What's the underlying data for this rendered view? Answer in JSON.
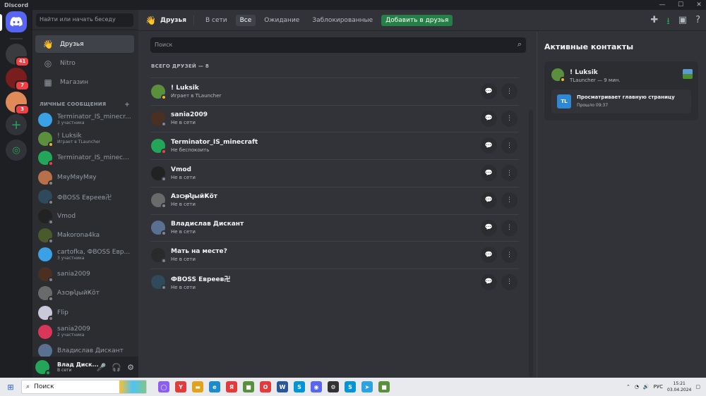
{
  "window": {
    "title": "Discord",
    "controls": [
      "—",
      "☐",
      "✕"
    ]
  },
  "guilds": [
    {
      "name": "server-1",
      "badge": "41",
      "color": "#3a3b3e"
    },
    {
      "name": "server-2",
      "badge": "7",
      "color": "#7a1d1d"
    },
    {
      "name": "server-3",
      "badge": "3",
      "color": "#e08a5a"
    }
  ],
  "sidebar": {
    "search_placeholder": "Найти или начать беседу",
    "nav": [
      {
        "label": "Друзья",
        "icon": "👋"
      },
      {
        "label": "Nitro",
        "icon": "◎"
      },
      {
        "label": "Магазин",
        "icon": "▦"
      }
    ],
    "dm_header": "ЛИЧНЫЕ СООБЩЕНИЯ",
    "dm_add": "+",
    "dms": [
      {
        "name": "Terminator_IS_minecr...",
        "sub": "3 участника",
        "color": "#3ba1e6",
        "status": ""
      },
      {
        "name": "! Luksik",
        "sub": "Играет в TLauncher",
        "color": "#5a8f3c",
        "status": "idle"
      },
      {
        "name": "Terminator_IS_minecra...",
        "sub": "",
        "color": "#23a55a",
        "status": "dnd"
      },
      {
        "name": "МяуМяуМяу",
        "sub": "",
        "color": "#b8704a",
        "status": "off"
      },
      {
        "name": "ФBOSS Евреев卍",
        "sub": "",
        "color": "#2f4a5a",
        "status": "off"
      },
      {
        "name": "Vmod",
        "sub": "",
        "color": "#222",
        "status": "off"
      },
      {
        "name": "Makorona4ka",
        "sub": "",
        "color": "#4a5a2a",
        "status": "off"
      },
      {
        "name": "cartofka, ФBOSS Евр...",
        "sub": "3 участника",
        "color": "#3ba1e6",
        "status": ""
      },
      {
        "name": "sania2009",
        "sub": "",
        "color": "#4a3020",
        "status": "off"
      },
      {
        "name": "АзѻᵽʮыйҜӧт",
        "sub": "",
        "color": "#6a6a6a",
        "status": "off"
      },
      {
        "name": "Flip",
        "sub": "",
        "color": "#c9c9d9",
        "status": "off"
      },
      {
        "name": "sania2009",
        "sub": "2 участника",
        "color": "#d9365a",
        "status": ""
      },
      {
        "name": "Владислав Дискант",
        "sub": "",
        "color": "#5a7090",
        "status": ""
      }
    ]
  },
  "user": {
    "name": "Влад Диск...",
    "status": "В сети",
    "color": "#23a55a",
    "icons": [
      "🎤",
      "🎧",
      "⚙"
    ]
  },
  "topbar": {
    "title": "Друзья",
    "tabs": [
      "В сети",
      "Все",
      "Ожидание",
      "Заблокированные"
    ],
    "add_friend": "Добавить в друзья",
    "right_icons": [
      "✚",
      "⭳",
      "▣",
      "?"
    ]
  },
  "friends": {
    "search_placeholder": "Поиск",
    "count_label": "ВСЕГО ДРУЗЕЙ — 8",
    "list": [
      {
        "name": "! Luksik",
        "sub": "Играет в TLauncher",
        "color": "#5a8f3c",
        "status": "idle"
      },
      {
        "name": "sania2009",
        "sub": "Не в сети",
        "color": "#4a3020",
        "status": "off"
      },
      {
        "name": "Terminator_IS_minecraft",
        "sub": "Не беспокоить",
        "color": "#23a55a",
        "status": "dnd"
      },
      {
        "name": "Vmod",
        "sub": "Не в сети",
        "color": "#222",
        "status": "off"
      },
      {
        "name": "АзѻᵽʮыйҜӧт",
        "sub": "Не в сети",
        "color": "#6a6a6a",
        "status": "off"
      },
      {
        "name": "Владислав Дискант",
        "sub": "Не в сети",
        "color": "#5a7090",
        "status": "off"
      },
      {
        "name": "Мать на месте?",
        "sub": "Не в сети",
        "color": "#2a2a2a",
        "status": "off"
      },
      {
        "name": "ФBOSS Евреев卍",
        "sub": "Не в сети",
        "color": "#2f4a5a",
        "status": "off"
      }
    ]
  },
  "active": {
    "title": "Активные контакты",
    "card": {
      "name": "! Luksik",
      "sub": "TLauncher — 9 мин.",
      "icon_text": "TL",
      "activity": "Просматривает главную страницу",
      "time": "Прошло 09:37"
    }
  },
  "taskbar": {
    "search": "Поиск",
    "apps": [
      {
        "label": "◯",
        "color": "#8b5cf6"
      },
      {
        "label": "Y",
        "color": "#e63a3a"
      },
      {
        "label": "▬",
        "color": "#e0a31a"
      },
      {
        "label": "e",
        "color": "#1b8ad1"
      },
      {
        "label": "Я",
        "color": "#e63a3a"
      },
      {
        "label": "■",
        "color": "#5a8f3c"
      },
      {
        "label": "O",
        "color": "#e63a3a"
      },
      {
        "label": "W",
        "color": "#2b579a"
      },
      {
        "label": "S",
        "color": "#0095d9"
      },
      {
        "label": "◉",
        "color": "#5865f2"
      },
      {
        "label": "⚙",
        "color": "#333"
      },
      {
        "label": "S",
        "color": "#0095d9"
      },
      {
        "label": "➤",
        "color": "#2aa3e0"
      },
      {
        "label": "■",
        "color": "#5a8f3c"
      }
    ],
    "lang": "РУС",
    "time": "15:21",
    "date": "03.04.2024"
  }
}
